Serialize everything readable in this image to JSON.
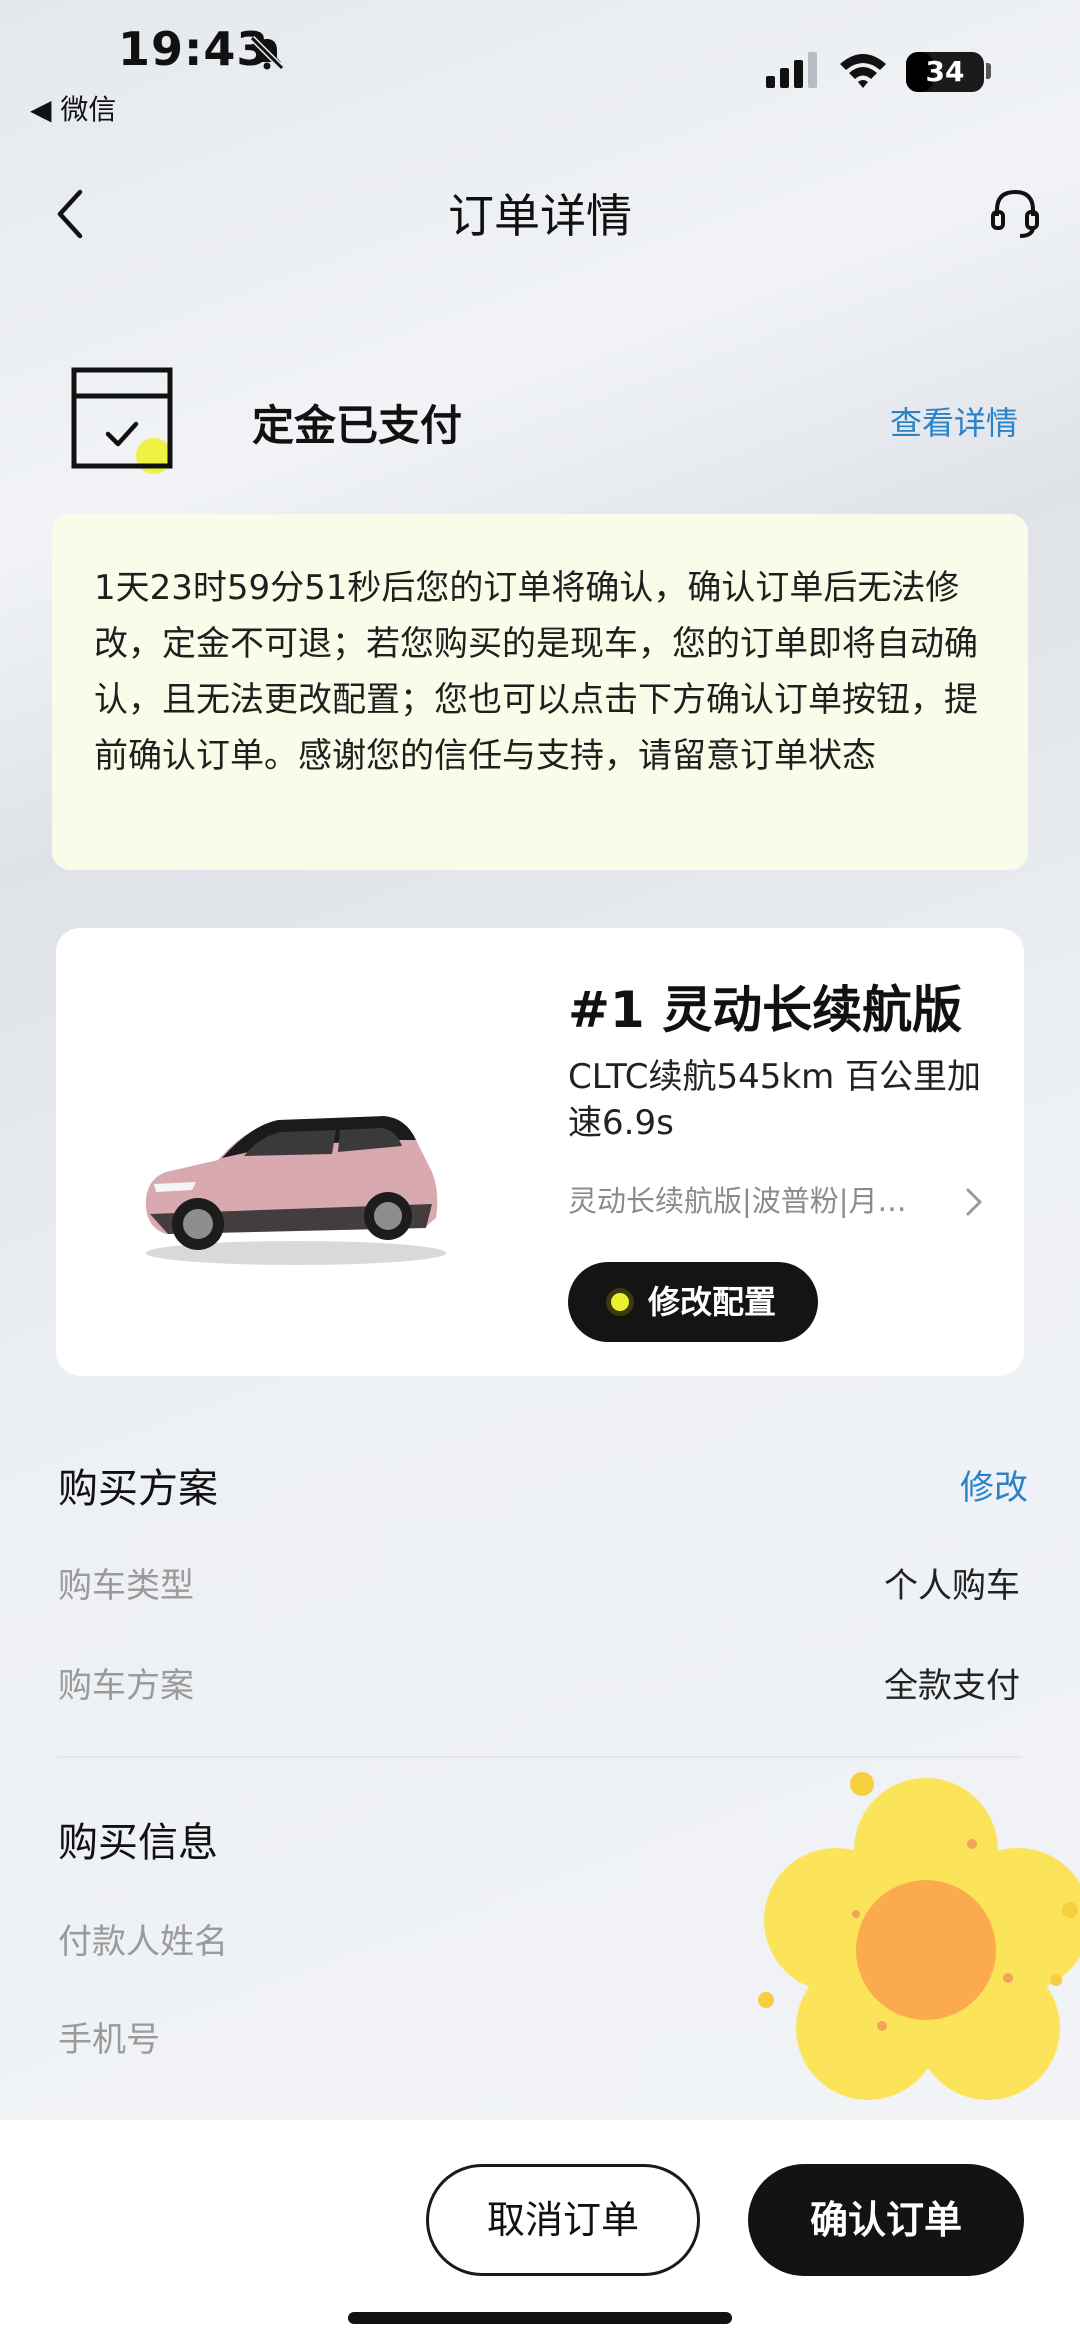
{
  "status_bar": {
    "time": "19:43",
    "back_app": "◀ 微信",
    "battery": "34",
    "battery_level": 0.34
  },
  "nav": {
    "title": "订单详情"
  },
  "order_status": {
    "title": "定金已支付",
    "detail_link": "查看详情"
  },
  "notice": {
    "text": "1天23时59分51秒后您的订单将确认，确认订单后无法修改，定金不可退；若您购买的是现车，您的订单即将自动确认，且无法更改配置；您也可以点击下方确认订单按钮，提前确认订单。感谢您的信任与支持，请留意订单状态"
  },
  "car": {
    "title": "#1 灵动长续航版",
    "description": "CLTC续航545km 百公里加速6.9s",
    "config": "灵动长续航版|波普粉|月…",
    "modify_button": "修改配置"
  },
  "purchase_plan": {
    "title": "购买方案",
    "edit": "修改",
    "rows": [
      {
        "label": "购车类型",
        "value": "个人购车"
      },
      {
        "label": "购车方案",
        "value": "全款支付"
      }
    ]
  },
  "purchase_info": {
    "title": "购买信息",
    "rows": [
      {
        "label": "付款人姓名",
        "value": ""
      },
      {
        "label": "手机号",
        "value": ""
      }
    ]
  },
  "actions": {
    "cancel": "取消订单",
    "confirm": "确认订单"
  },
  "colors": {
    "accent_link": "#2a82c7",
    "notice_bg": "#fbfbe9",
    "button_dark": "#131313",
    "highlight_yellow": "#e9f02d"
  }
}
